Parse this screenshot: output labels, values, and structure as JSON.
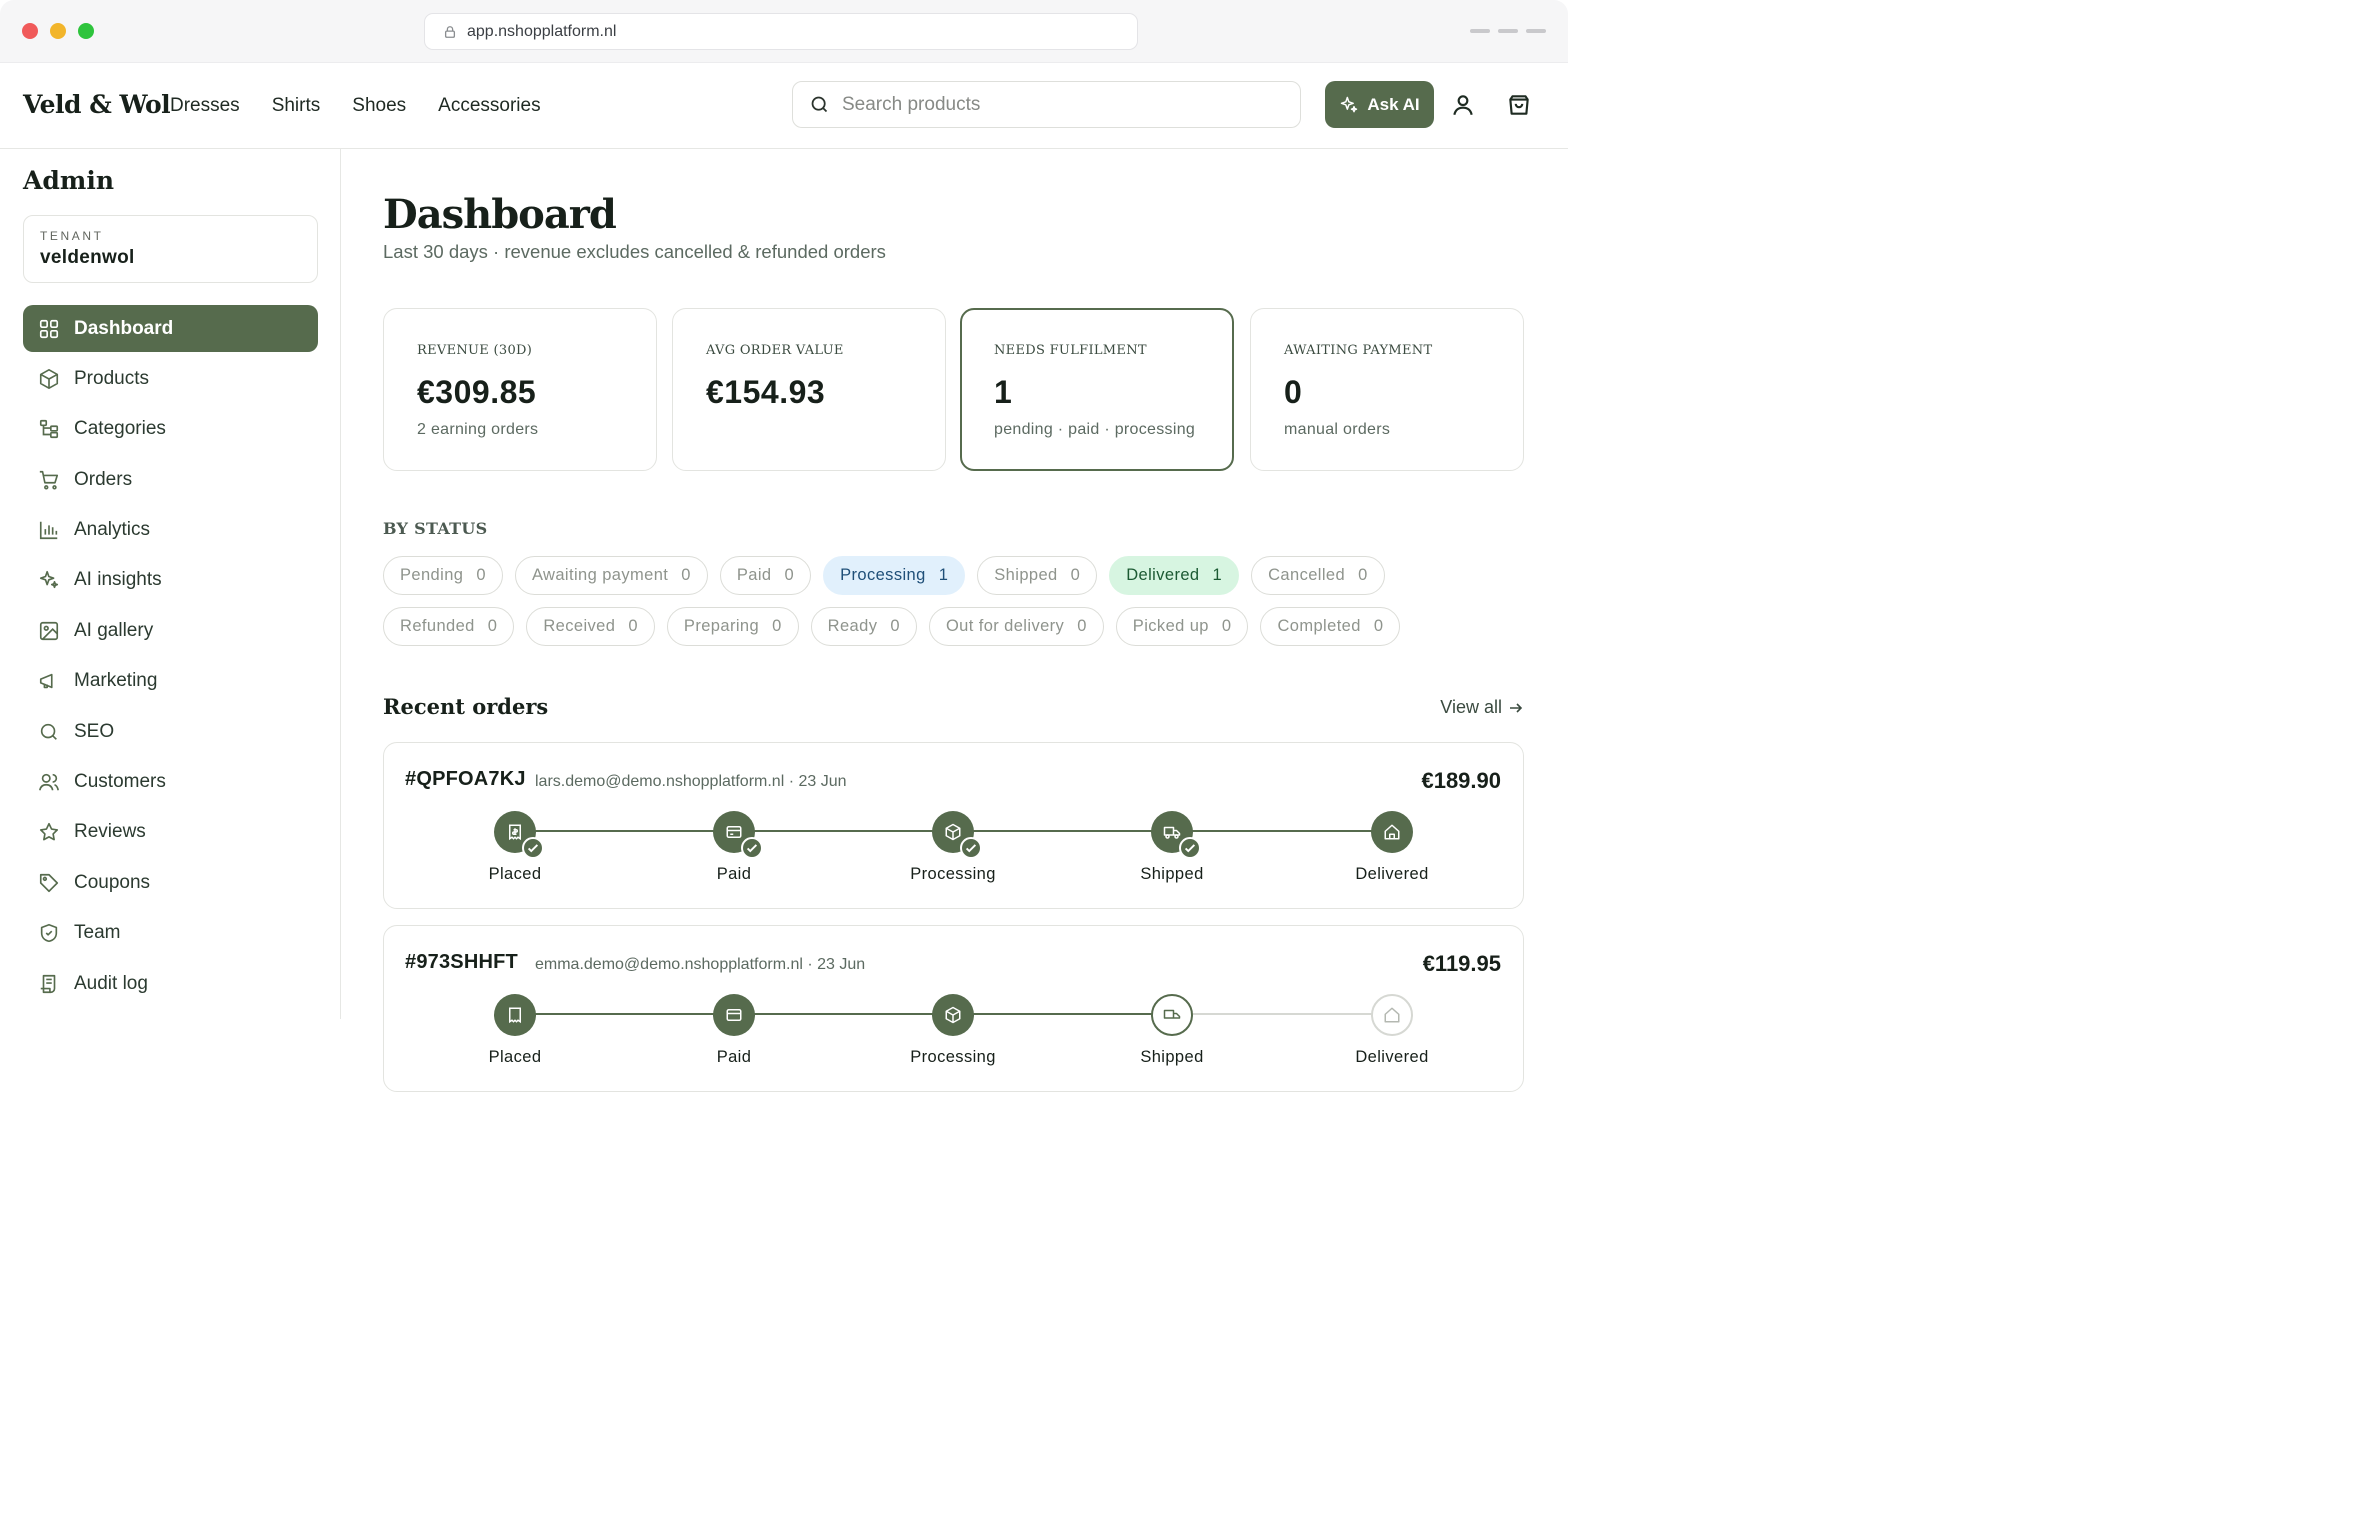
{
  "browser": {
    "url": "app.nshopplatform.nl"
  },
  "header": {
    "brand": "Veld & Wol",
    "nav": [
      "Dresses",
      "Shirts",
      "Shoes",
      "Accessories"
    ],
    "search_placeholder": "Search products",
    "ask_ai": "Ask AI",
    "icons": {
      "account": "user-icon",
      "cart": "shopping-bag-icon"
    }
  },
  "sidebar": {
    "title": "Admin",
    "tenant_label": "TENANT",
    "tenant_value": "veldenwol",
    "items": [
      {
        "label": "Dashboard",
        "icon": "dashboard-icon",
        "active": true
      },
      {
        "label": "Products",
        "icon": "box-icon"
      },
      {
        "label": "Categories",
        "icon": "tree-icon"
      },
      {
        "label": "Orders",
        "icon": "cart-icon"
      },
      {
        "label": "Analytics",
        "icon": "bar-chart-icon"
      },
      {
        "label": "AI insights",
        "icon": "sparkles-icon"
      },
      {
        "label": "AI gallery",
        "icon": "image-icon"
      },
      {
        "label": "Marketing",
        "icon": "megaphone-icon"
      },
      {
        "label": "SEO",
        "icon": "search-icon"
      },
      {
        "label": "Customers",
        "icon": "users-icon"
      },
      {
        "label": "Reviews",
        "icon": "star-icon"
      },
      {
        "label": "Coupons",
        "icon": "tag-icon"
      },
      {
        "label": "Team",
        "icon": "shield-icon"
      },
      {
        "label": "Audit log",
        "icon": "log-icon"
      }
    ]
  },
  "main": {
    "title": "Dashboard",
    "subtitle": "Last 30 days · revenue excludes cancelled & refunded orders",
    "stats": [
      {
        "label": "REVENUE (30D)",
        "value": "€309.85",
        "note": "2 earning orders"
      },
      {
        "label": "AVG ORDER VALUE",
        "value": "€154.93",
        "note": ""
      },
      {
        "label": "NEEDS FULFILMENT",
        "value": "1",
        "note": "pending · paid · processing",
        "highlight": true
      },
      {
        "label": "AWAITING PAYMENT",
        "value": "0",
        "note": "manual orders"
      }
    ],
    "by_status_title": "BY STATUS",
    "statuses": [
      {
        "label": "Pending",
        "count": "0"
      },
      {
        "label": "Awaiting payment",
        "count": "0"
      },
      {
        "label": "Paid",
        "count": "0"
      },
      {
        "label": "Processing",
        "count": "1",
        "tone": "blue"
      },
      {
        "label": "Shipped",
        "count": "0"
      },
      {
        "label": "Delivered",
        "count": "1",
        "tone": "green"
      },
      {
        "label": "Cancelled",
        "count": "0"
      },
      {
        "label": "Refunded",
        "count": "0"
      },
      {
        "label": "Received",
        "count": "0"
      },
      {
        "label": "Preparing",
        "count": "0"
      },
      {
        "label": "Ready",
        "count": "0"
      },
      {
        "label": "Out for delivery",
        "count": "0"
      },
      {
        "label": "Picked up",
        "count": "0"
      },
      {
        "label": "Completed",
        "count": "0"
      }
    ],
    "recent_title": "Recent orders",
    "view_all": "View all",
    "orders": [
      {
        "id": "#QPFOA7KJ",
        "meta": "lars.demo@demo.nshopplatform.nl · 23 Jun",
        "amount": "€189.90",
        "steps": [
          "Placed",
          "Paid",
          "Processing",
          "Shipped",
          "Delivered"
        ]
      },
      {
        "id": "#973SHHFT",
        "meta": "emma.demo@demo.nshopplatform.nl · 23 Jun",
        "amount": "€119.95",
        "steps": [
          "Placed",
          "Paid",
          "Processing",
          "Shipped",
          "Delivered"
        ]
      }
    ]
  },
  "colors": {
    "accent": "#566b4d",
    "processing_bg": "#e1f0fc",
    "delivered_bg": "#d7f5e1"
  }
}
